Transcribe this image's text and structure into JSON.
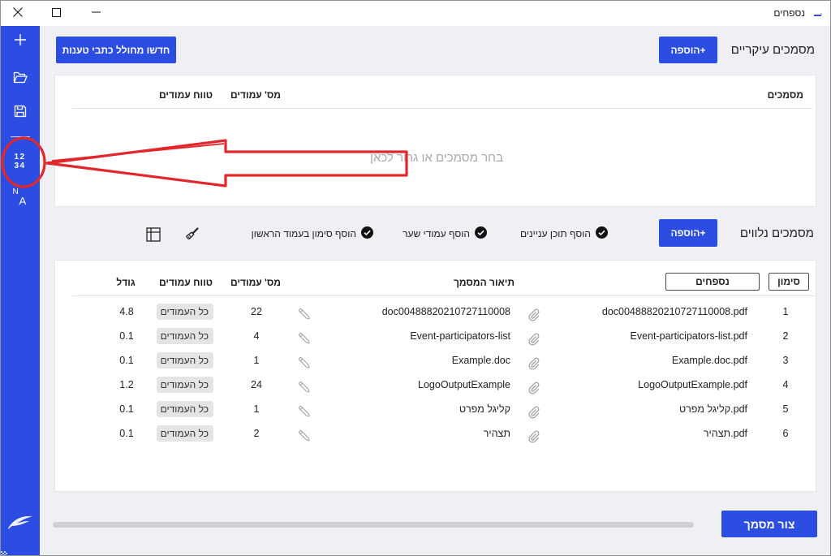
{
  "window": {
    "title": "נספחים",
    "app_icon": "app-icon",
    "controls": {
      "close": "close-icon",
      "maximize": "maximize-icon",
      "minimize": "minimize-icon"
    }
  },
  "sidebar": {
    "items": [
      {
        "id": "new",
        "icon": "plus-icon"
      },
      {
        "id": "open",
        "icon": "folder-open-icon"
      },
      {
        "id": "save",
        "icon": "save-icon"
      },
      {
        "id": "numbering",
        "icon": "numbering-icon",
        "glyph_top": "12",
        "glyph_bottom": "34"
      },
      {
        "id": "translate",
        "icon": "translate-icon",
        "glyph_top": "N",
        "glyph_bottom": "A"
      }
    ],
    "logo": "feather-logo-icon"
  },
  "main_documents": {
    "title": "מסמכים עיקריים",
    "add_button": "הוספה+",
    "generator_button": "חדשו מחולל כתבי טענות",
    "columns": {
      "documents": "מסמכים",
      "page_count": "מס' עמודים",
      "page_range": "טווח עמודים"
    },
    "placeholder": "בחר מסמכים או גרור לכאן"
  },
  "attachments": {
    "title": "מסמכים נלווים",
    "add_button": "הוספה+",
    "options": [
      {
        "label": "הוסף תוכן עניינים",
        "checked": true
      },
      {
        "label": "הוסף עמודי שער",
        "checked": true
      },
      {
        "label": "הוסף סימון בעמוד הראשון",
        "checked": true
      }
    ],
    "tools": [
      "brush-icon",
      "table-icon"
    ],
    "columns": {
      "mark": "סימון",
      "attachments": "נספחים",
      "description": "תיאור המסמך",
      "page_count": "מס' עמודים",
      "page_range": "טווח עמודים",
      "size": "גודל"
    },
    "rows": [
      {
        "mark": "1",
        "file": "doc00488820210727110008.pdf",
        "description": "doc00488820210727110008",
        "pages": "22",
        "range": "כל העמודים",
        "size": "4.8"
      },
      {
        "mark": "2",
        "file": "Event-participators-list.pdf",
        "description": "Event-participators-list",
        "pages": "4",
        "range": "כל העמודים",
        "size": "0.1"
      },
      {
        "mark": "3",
        "file": "Example.doc.pdf",
        "description": "Example.doc",
        "pages": "1",
        "range": "כל העמודים",
        "size": "0.1"
      },
      {
        "mark": "4",
        "file": "LogoOutputExample.pdf",
        "description": "LogoOutputExample",
        "pages": "24",
        "range": "כל העמודים",
        "size": "1.2"
      },
      {
        "mark": "5",
        "file": "קליגל מפרט.pdf",
        "description": "קליגל מפרט",
        "pages": "1",
        "range": "כל העמודים",
        "size": "0.1"
      },
      {
        "mark": "6",
        "file": "תצהיר.pdf",
        "description": "תצהיר",
        "pages": "2",
        "range": "כל העמודים",
        "size": "0.1"
      }
    ]
  },
  "footer": {
    "create_button": "צור מסמך"
  },
  "colors": {
    "accent": "#2c4de2",
    "annotation": "#e3262b",
    "background": "#eff0f3",
    "panel": "#ffffff",
    "pill": "#e4e4e6"
  }
}
